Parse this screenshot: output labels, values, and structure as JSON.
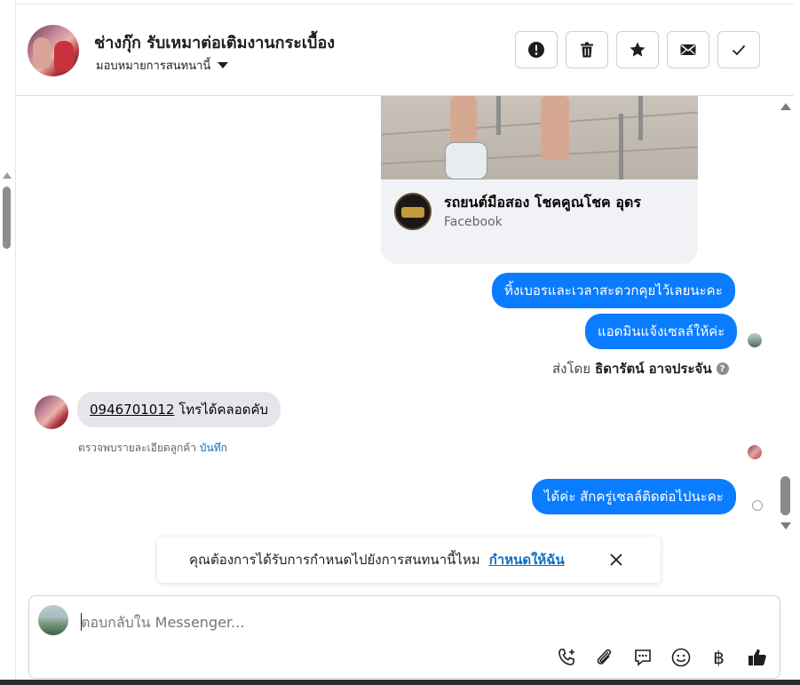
{
  "header": {
    "contact_name": "ช่างกุ๊ก รับเหมาต่อเติมงานกระเบื้อง",
    "assign_label": "มอบหมายการสนทนานี้",
    "actions": [
      "mark-spam",
      "delete",
      "star",
      "mark-unread",
      "mark-done"
    ]
  },
  "shared_card": {
    "page_name": "รถยนต์มือสอง โชคคูณโชค อุดร",
    "source": "Facebook"
  },
  "messages": {
    "out_1": "ทิ้งเบอรและเวลาสะดวกคุยไว้เลยนะคะ",
    "out_2": "แอดมินแจ้งเซลล์ให้ค่ะ",
    "sent_by_prefix": "ส่งโดย",
    "sent_by_name": "ธิดารัตน์ อาจประจัน",
    "help_glyph": "?",
    "in_1_phone": "0946701012",
    "in_1_text": " โทรได้คลอดคับ",
    "note_text": "ตรวจพบรายละเอียดลูกค้า ",
    "note_link": "บันทึก",
    "out_3": "ได้ค่ะ สักครู่เซลล์ติดต่อไปนะคะ"
  },
  "assign_prompt": {
    "question": "คุณต้องการได้รับการกำหนดไปยังการสนทนานี้ไหม",
    "action": "กำหนดให้ฉัน"
  },
  "composer": {
    "placeholder": "ตอบกลับใน Messenger...",
    "tools": [
      "call-add-icon",
      "attachment-icon",
      "saved-reply-icon",
      "emoji-icon",
      "baht-icon",
      "like-icon"
    ],
    "baht_glyph": "฿"
  },
  "colors": {
    "outgoing_bubble": "#0a7cff",
    "incoming_bubble": "#e4e6eb",
    "link": "#0a6fc2"
  }
}
